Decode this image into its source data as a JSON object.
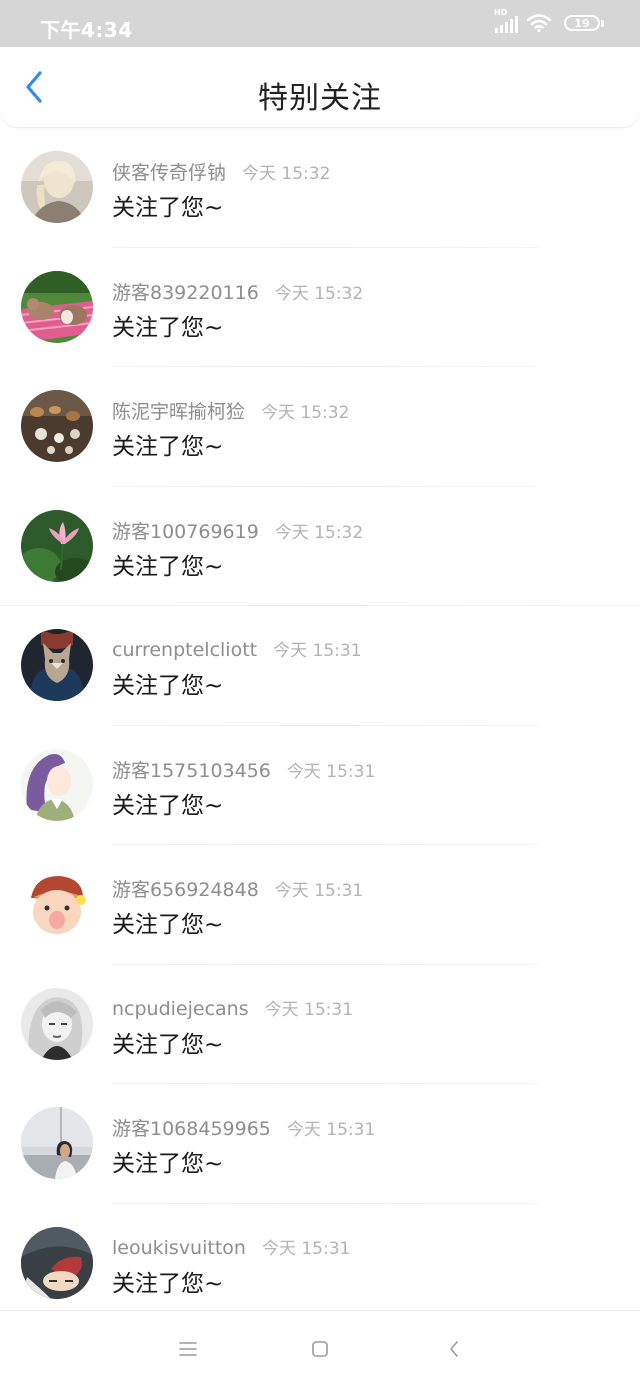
{
  "status_bar": {
    "time": "下午4:34",
    "network": "HD",
    "battery": "19"
  },
  "header": {
    "title": "特别关注"
  },
  "followers": [
    {
      "name": "侠客传奇俘钠",
      "time": "今天 15:32",
      "message": "关注了您~"
    },
    {
      "name": "游客839220116",
      "time": "今天 15:32",
      "message": "关注了您~"
    },
    {
      "name": "陈泥宇晖揄柯猃",
      "time": "今天 15:32",
      "message": "关注了您~"
    },
    {
      "name": "游客100769619",
      "time": "今天 15:32",
      "message": "关注了您~"
    },
    {
      "name": "currenptelcliott",
      "time": "今天 15:31",
      "message": "关注了您~"
    },
    {
      "name": "游客1575103456",
      "time": "今天 15:31",
      "message": "关注了您~"
    },
    {
      "name": "游客656924848",
      "time": "今天 15:31",
      "message": "关注了您~"
    },
    {
      "name": "ncpudiejecans",
      "time": "今天 15:31",
      "message": "关注了您~"
    },
    {
      "name": "游客1068459965",
      "time": "今天 15:31",
      "message": "关注了您~"
    },
    {
      "name": "leoukisvuitton",
      "time": "今天 15:31",
      "message": "关注了您~"
    }
  ],
  "icons": {
    "back": "chevron-left-icon",
    "menu": "menu-icon",
    "home": "square-home-icon",
    "nav_back": "nav-back-icon"
  },
  "colors": {
    "accent": "#2d8cf0",
    "status_bar": "#d6d6d6"
  }
}
